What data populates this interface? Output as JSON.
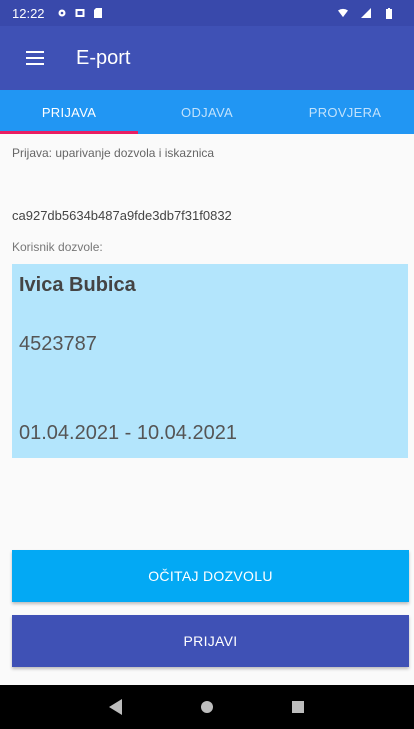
{
  "status_bar": {
    "time": "12:22",
    "icons_left": [
      "gear-icon",
      "image-icon",
      "sim-card-icon"
    ],
    "icons_right": [
      "wifi-icon",
      "signal-icon",
      "battery-icon"
    ]
  },
  "app_bar": {
    "title": "E-port",
    "menu_icon": "hamburger-icon",
    "colors": {
      "primary": "#3f51b5",
      "status": "#3949ab"
    }
  },
  "tabs": [
    {
      "label": "PRIJAVA",
      "active": true
    },
    {
      "label": "ODJAVA",
      "active": false
    },
    {
      "label": "PROVJERA",
      "active": false
    }
  ],
  "tab_colors": {
    "background": "#2196f3",
    "indicator": "#e91e63"
  },
  "main": {
    "subtitle": "Prijava: uparivanje dozvola i iskaznica",
    "hash": "ca927db5634b487a9fde3db7f31f0832",
    "holder_label": "Korisnik dozvole:",
    "card": {
      "name": "Ivica Bubica",
      "number": "4523787",
      "validity": "01.04.2021 - 10.04.2021",
      "background": "#b3e5fc"
    }
  },
  "buttons": {
    "read_permit": "OČITAJ DOZVOLU",
    "submit": "PRIJAVI"
  },
  "nav_bar": {
    "icons": [
      "back-icon",
      "home-icon",
      "recents-icon"
    ]
  }
}
